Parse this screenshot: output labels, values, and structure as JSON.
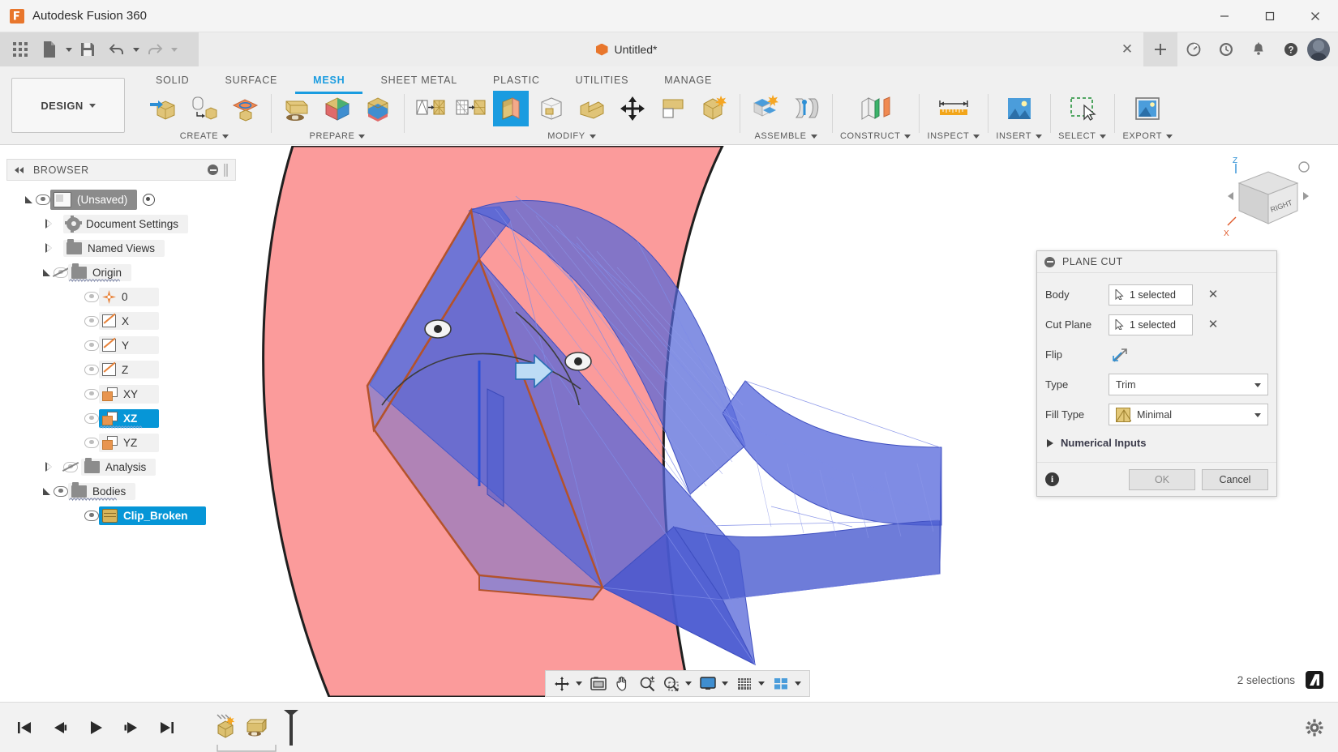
{
  "window": {
    "app_title": "Autodesk Fusion 360",
    "app_icon": "fusion-logo-icon",
    "minimize": "─",
    "maximize": "☐",
    "close": "✕"
  },
  "quick_access": {
    "items": [
      {
        "name": "app-grid-icon",
        "label": ""
      },
      {
        "name": "new-file-icon",
        "label": ""
      },
      {
        "name": "save-icon",
        "label": ""
      },
      {
        "name": "undo-icon",
        "label": ""
      },
      {
        "name": "redo-icon",
        "label": ""
      }
    ]
  },
  "document_tab": {
    "title": "Untitled*",
    "close": "✕",
    "new_tab": "+"
  },
  "tabbar_right": {
    "icons": [
      "job-status-icon",
      "recent-activity-icon",
      "notifications-bell-icon",
      "help-icon",
      "account-avatar"
    ]
  },
  "ribbon": {
    "workspace": "DESIGN",
    "workspace_caret": "▾",
    "tabs": [
      {
        "label": "SOLID",
        "active": false
      },
      {
        "label": "SURFACE",
        "active": false
      },
      {
        "label": "MESH",
        "active": true
      },
      {
        "label": "SHEET METAL",
        "active": false
      },
      {
        "label": "PLASTIC",
        "active": false
      },
      {
        "label": "UTILITIES",
        "active": false
      },
      {
        "label": "MANAGE",
        "active": false
      }
    ],
    "groups": [
      {
        "label": "CREATE",
        "has_caret": true,
        "tools": [
          "create-mesh-icon",
          "bref-to-mesh-icon",
          "mesh-from-sketch-icon"
        ]
      },
      {
        "label": "PREPARE",
        "has_caret": true,
        "tools": [
          "mesh-section-icon",
          "separate-mesh-icon",
          "merge-bodies-icon"
        ]
      },
      {
        "label": "MODIFY",
        "has_caret": true,
        "tools": [
          "remesh-icon",
          "reduce-icon",
          "plane-cut-icon",
          "make-closed-mesh-icon",
          "erase-and-fill-icon",
          "move-copy-icon",
          "delete-faces-icon",
          "generate-face-groups-icon"
        ]
      },
      {
        "label": "ASSEMBLE",
        "has_caret": true,
        "tools": [
          "new-component-icon",
          "joint-icon"
        ]
      },
      {
        "label": "CONSTRUCT",
        "has_caret": true,
        "tools": [
          "offset-plane-icon"
        ]
      },
      {
        "label": "INSPECT",
        "has_caret": true,
        "tools": [
          "measure-icon"
        ]
      },
      {
        "label": "INSERT",
        "has_caret": true,
        "tools": [
          "insert-image-icon"
        ]
      },
      {
        "label": "SELECT",
        "has_caret": true,
        "tools": [
          "window-selection-icon"
        ]
      },
      {
        "label": "EXPORT",
        "has_caret": true,
        "tools": [
          "export-icon"
        ]
      }
    ]
  },
  "browser": {
    "title": "BROWSER",
    "collapse_icon": "collapse-left-icon",
    "minus_icon": "circle-minus-icon",
    "grip_icon": "panel-grip-icon",
    "tree": [
      {
        "label": "(Unsaved)",
        "indent": 0,
        "expander": "open",
        "eye": "on",
        "icon": "document-cube-icon",
        "state": "selected-dark",
        "trailing": "radio-active-icon"
      },
      {
        "label": "Document Settings",
        "indent": 1,
        "expander": "closed",
        "eye": "none",
        "icon": "gear-icon",
        "state": "normal"
      },
      {
        "label": "Named Views",
        "indent": 1,
        "expander": "closed",
        "eye": "none",
        "icon": "folder-icon",
        "state": "normal"
      },
      {
        "label": "Origin",
        "indent": 1,
        "expander": "open",
        "eye": "hidden",
        "icon": "folder-icon",
        "state": "scribbled"
      },
      {
        "label": "0",
        "indent": 2,
        "expander": "none",
        "eye": "dim",
        "icon": "origin-point-icon",
        "state": "normal"
      },
      {
        "label": "X",
        "indent": 2,
        "expander": "none",
        "eye": "dim",
        "icon": "axis-plane-icon",
        "state": "normal"
      },
      {
        "label": "Y",
        "indent": 2,
        "expander": "none",
        "eye": "dim",
        "icon": "axis-plane-icon",
        "state": "normal"
      },
      {
        "label": "Z",
        "indent": 2,
        "expander": "none",
        "eye": "dim",
        "icon": "axis-plane-icon",
        "state": "normal"
      },
      {
        "label": "XY",
        "indent": 2,
        "expander": "none",
        "eye": "dim",
        "icon": "construction-plane-icon",
        "state": "normal"
      },
      {
        "label": "XZ",
        "indent": 2,
        "expander": "none",
        "eye": "dim",
        "icon": "construction-plane-icon",
        "state": "selected-blue"
      },
      {
        "label": "YZ",
        "indent": 2,
        "expander": "none",
        "eye": "dim",
        "icon": "construction-plane-icon",
        "state": "normal"
      },
      {
        "label": "Analysis",
        "indent": 1,
        "expander": "closed",
        "eye": "hidden",
        "icon": "folder-icon",
        "state": "normal"
      },
      {
        "label": "Bodies",
        "indent": 1,
        "expander": "open",
        "eye": "on",
        "icon": "folder-icon",
        "state": "scribbled"
      },
      {
        "label": "Clip_Broken",
        "indent": 2,
        "expander": "none",
        "eye": "on",
        "icon": "mesh-body-icon",
        "state": "selected-blue"
      }
    ]
  },
  "dialog": {
    "title": "PLANE CUT",
    "collapse_icon": "circle-minus-icon",
    "rows": [
      {
        "label": "Body",
        "kind": "selection",
        "value": "1 selected",
        "clear": "✕",
        "icon": "select-cursor-icon"
      },
      {
        "label": "Cut Plane",
        "kind": "selection",
        "value": "1 selected",
        "clear": "✕",
        "icon": "select-cursor-icon"
      },
      {
        "label": "Flip",
        "kind": "button",
        "icon": "flip-direction-icon"
      },
      {
        "label": "Type",
        "kind": "dropdown",
        "value": "Trim",
        "arrow": "▾"
      },
      {
        "label": "Fill Type",
        "kind": "dropdown",
        "value": "Minimal",
        "arrow": "▾",
        "swatch": "minimal-fill-icon"
      }
    ],
    "expander": {
      "label": "Numerical Inputs",
      "arrow": "▶",
      "expanded": false
    },
    "footer": {
      "info_icon": "info-icon",
      "info_glyph": "i",
      "ok_label": "OK",
      "cancel_label": "Cancel"
    }
  },
  "nav_toolbar": {
    "items": [
      {
        "name": "orbit-icon",
        "caret": true
      },
      {
        "name": "look-at-icon",
        "caret": false
      },
      {
        "name": "pan-icon",
        "caret": false
      },
      {
        "name": "zoom-icon",
        "caret": false
      },
      {
        "name": "zoom-window-icon",
        "caret": true
      },
      {
        "name": "display-settings-icon",
        "caret": true
      },
      {
        "name": "grid-snaps-icon",
        "caret": true
      },
      {
        "name": "viewports-icon",
        "caret": true
      }
    ]
  },
  "viewcube": {
    "face_label": "RIGHT",
    "axis_z": "Z",
    "axis_x": "X"
  },
  "status": {
    "selection_text": "2 selections",
    "badge": "fusion-logo-badge"
  },
  "timeline": {
    "controls": [
      "go-to-beginning-icon",
      "step-back-icon",
      "play-icon",
      "step-forward-icon",
      "go-to-end-icon"
    ],
    "features": [
      "mesh-body-feature-icon",
      "plane-cut-feature-icon"
    ],
    "marker": "timeline-end-marker",
    "settings": "settings-gear-icon"
  },
  "canvas": {
    "plane_color": "#f79a9a",
    "body_color": "#5566d8",
    "selected_edge_color": "#b4522a",
    "arrow_color": "#bddcf5"
  }
}
